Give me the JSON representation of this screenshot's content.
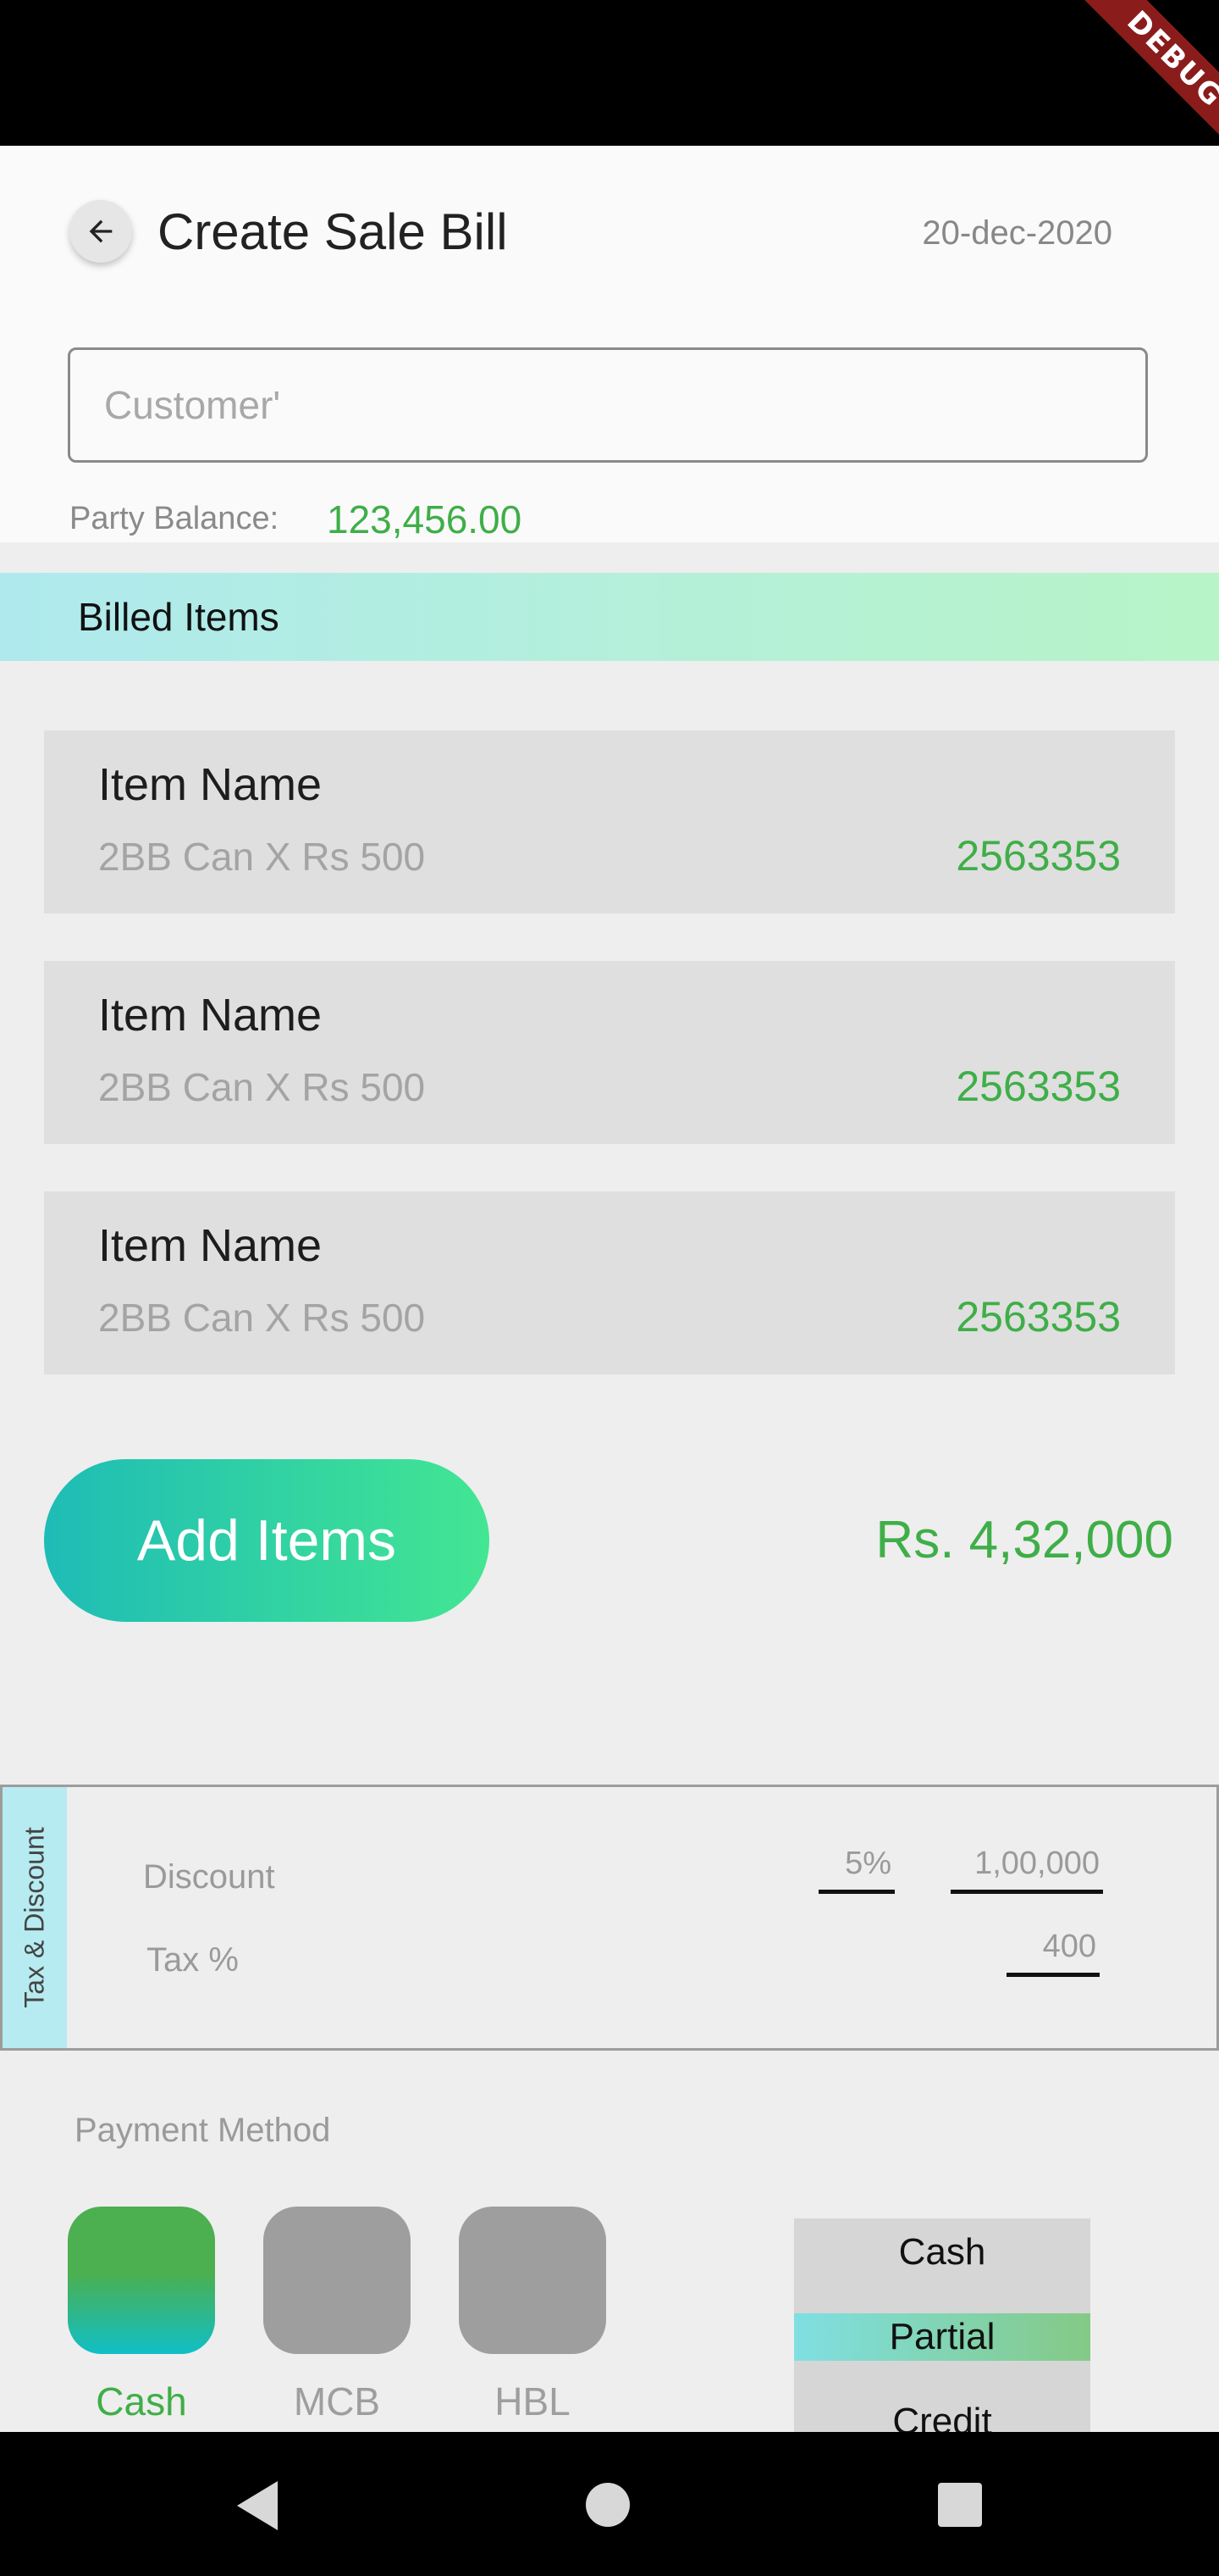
{
  "status_bar": {
    "debug_label": "DEBUG"
  },
  "header": {
    "back_icon": "arrow-left-icon",
    "title": "Create Sale Bill",
    "date": "20-dec-2020"
  },
  "customer": {
    "placeholder": "Customer'",
    "value": ""
  },
  "party_balance": {
    "label": "Party Balance:",
    "value": "123,456.00"
  },
  "billed_items": {
    "title": "Billed Items",
    "items": [
      {
        "name": "Item Name",
        "description": "2BB Can X Rs 500",
        "amount": "2563353"
      },
      {
        "name": "Item Name",
        "description": "2BB Can X Rs 500",
        "amount": "2563353"
      },
      {
        "name": "Item Name",
        "description": "2BB Can X Rs 500",
        "amount": "2563353"
      }
    ]
  },
  "actions": {
    "add_items_label": "Add Items",
    "total": "Rs. 4,32,000"
  },
  "tax_discount": {
    "title": "Tax & Discount",
    "discount_label": "Discount",
    "discount_percent": "5%",
    "discount_amount": "1,00,000",
    "tax_label": "Tax %",
    "tax_value": "400"
  },
  "payment": {
    "title": "Payment Method",
    "methods": [
      {
        "label": "Cash",
        "selected": true
      },
      {
        "label": "MCB",
        "selected": false
      },
      {
        "label": "HBL",
        "selected": false
      }
    ],
    "options": [
      "Cash",
      "Partial",
      "Credit"
    ],
    "selected_option": "Partial"
  },
  "colors": {
    "accent_green": "#3fae48",
    "gradient_start": "#1ebcb6",
    "gradient_end": "#43e692"
  },
  "nav": {
    "back_icon": "triangle-back-icon",
    "home_icon": "circle-home-icon",
    "recents_icon": "square-recents-icon"
  }
}
